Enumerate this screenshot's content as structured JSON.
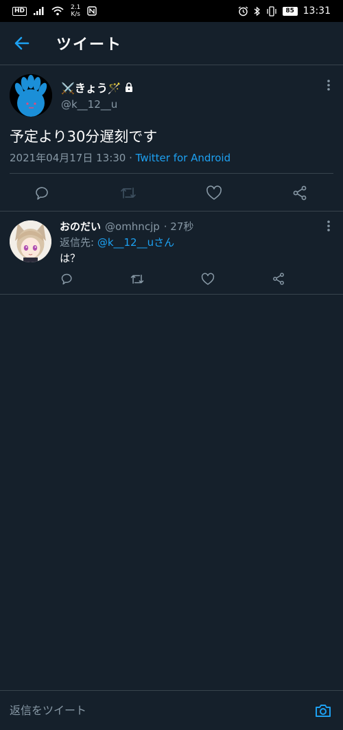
{
  "status_bar": {
    "hd": "HD",
    "net_speed_value": "2.1",
    "net_speed_unit": "K/s",
    "battery": "85",
    "time": "13:31"
  },
  "header": {
    "title": "ツイート",
    "back_icon": "arrow-left-icon"
  },
  "tweet": {
    "display_name": "⚔️きょう🪄",
    "protected_icon": "lock-icon",
    "handle": "@k__12__u",
    "text": "予定より30分遅刻です",
    "timestamp": "2021年04月17日 13:30",
    "separator": " · ",
    "source": "Twitter for Android",
    "actions": [
      "reply-icon",
      "retweet-icon",
      "like-icon",
      "share-icon"
    ]
  },
  "reply": {
    "display_name": "おのだい",
    "handle": "@omhncjp",
    "time": "· 27秒",
    "replying_label": "返信先: ",
    "replying_to": "@k__12__uさん",
    "text": "は？"
  },
  "compose": {
    "placeholder": "返信をツイート",
    "camera_icon": "camera-icon"
  },
  "colors": {
    "background": "#15202b",
    "accent": "#1da1f2",
    "secondary_text": "#8899a6",
    "divider": "#38444d"
  }
}
